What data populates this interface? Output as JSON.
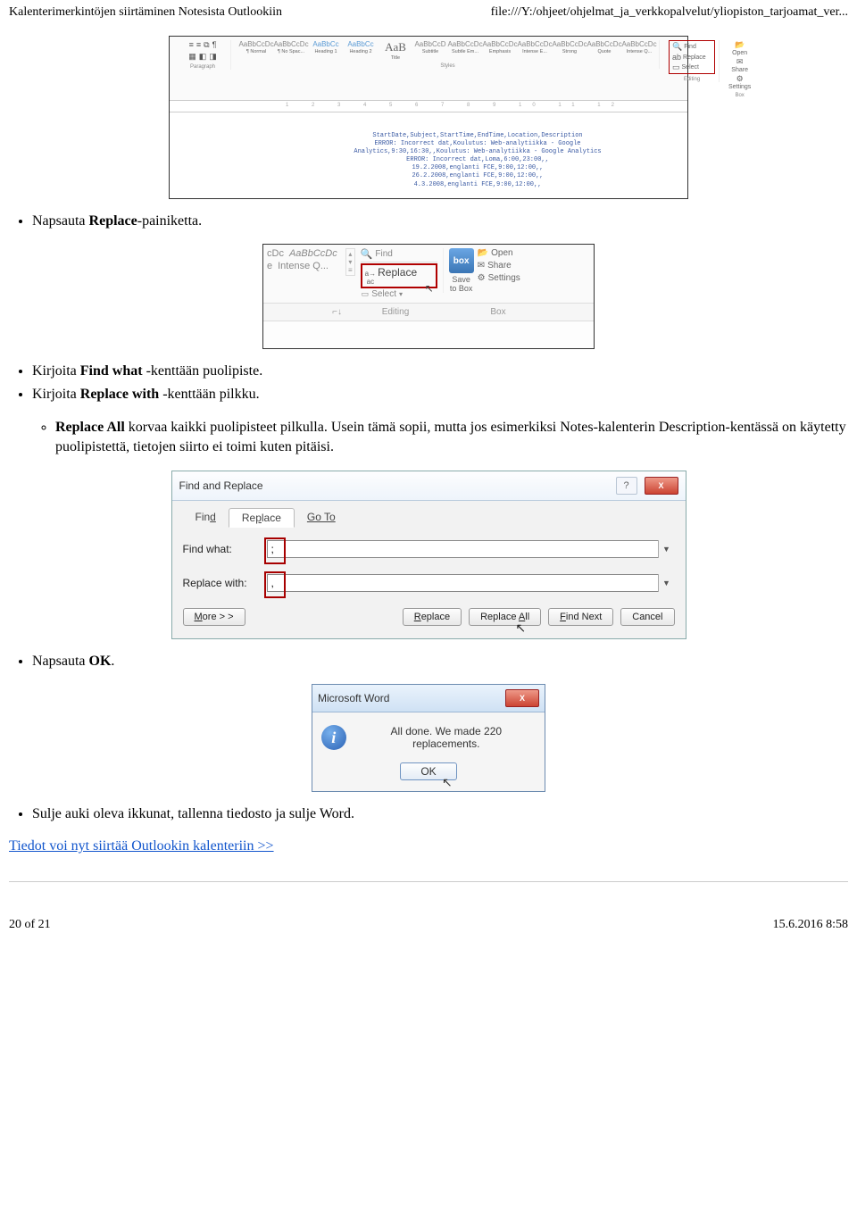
{
  "header": {
    "left": "Kalenterimerkintöjen siirtäminen Notesista Outlookiin",
    "right": "file:///Y:/ohjeet/ohjelmat_ja_verkkopalvelut/yliopiston_tarjoamat_ver..."
  },
  "footer": {
    "left": "20 of 21",
    "right": "15.6.2016 8:58"
  },
  "bullets": {
    "b1a": "Napsauta ",
    "b1b": "Replace",
    "b1c": "-painiketta.",
    "b2a": "Kirjoita ",
    "b2b": "Find what",
    "b2c": " -kenttään puolipiste.",
    "b3a": "Kirjoita ",
    "b3b": "Replace with",
    "b3c": " -kenttään pilkku.",
    "b4a": "Replace All",
    "b4b": " korvaa kaikki puolipisteet pilkulla. Usein tämä sopii, mutta jos esimerkiksi Notes-kalenterin Description-kentässä on käytetty puolipistettä, tietojen siirto ei toimi kuten pitäisi.",
    "b5a": "Napsauta ",
    "b5b": "OK",
    "b5c": ".",
    "b6": "Sulje auki oleva ikkunat, tallenna tiedosto ja sulje Word."
  },
  "link": "Tiedot voi nyt siirtää Outlookin kalenteriin >>",
  "ss1": {
    "ruler": "1 2 3 4 5 6 7 8 9 10 11 12",
    "groups": {
      "paragraph": "Paragraph",
      "styles": "Styles",
      "editing": "Editing",
      "box": "Box"
    },
    "styles": [
      {
        "p": "AaBbCcDc",
        "n": "¶ Normal"
      },
      {
        "p": "AaBbCcDc",
        "n": "¶ No Spac..."
      },
      {
        "p": "AaBbCc",
        "n": "Heading 1"
      },
      {
        "p": "AaBbCc",
        "n": "Heading 2"
      },
      {
        "p": "AaB",
        "n": "Title"
      },
      {
        "p": "AaBbCcD",
        "n": "Subtitle"
      },
      {
        "p": "AaBbCcDc",
        "n": "Subtle Em..."
      },
      {
        "p": "AaBbCcDc",
        "n": "Emphasis"
      },
      {
        "p": "AaBbCcDc",
        "n": "Intense E..."
      },
      {
        "p": "AaBbCcDc",
        "n": "Strong"
      },
      {
        "p": "AaBbCcDc",
        "n": "Quote"
      },
      {
        "p": "AaBbCcDc",
        "n": "Intense Q..."
      }
    ],
    "editing": {
      "find": "Find",
      "replace": "Replace",
      "select": "Select"
    },
    "boxlinks": {
      "open": "Open",
      "share": "Share",
      "settings": "Settings"
    },
    "doc": "StartDate,Subject,StartTime,EndTime,Location,Description\nERROR: Incorrect dat,Koulutus: Web-analytiikka - Google\nAnalytics,9:30,16:30,,Koulutus: Web-analytiikka - Google Analytics\nERROR: Incorrect dat,Loma,6:00,23:00,,\n19.2.2008,englanti FCE,9:00,12:00,,\n26.2.2008,englanti FCE,9:00,12:00,,\n4.3.2008,englanti FCE,9:00,12:00,,"
  },
  "ss2": {
    "style1": "cDc",
    "style2": "AaBbCcDc",
    "style3": "e",
    "style4": "Intense Q...",
    "find": "Find",
    "replace": "Replace",
    "select": "Select",
    "save": "Save",
    "tobox": "to Box",
    "open": "Open",
    "share": "Share",
    "settings": "Settings",
    "labEditing": "Editing",
    "labBox": "Box",
    "labLeft": "⌐↓",
    "boxtext": "box"
  },
  "ss3": {
    "title": "Find and Replace",
    "tabFind": "Fin",
    "tabFindU": "d",
    "tabReplace": "Re",
    "tabReplaceU": "p",
    "tabReplace2": "lace",
    "tabGoto": "Go To",
    "lblFind": "Find what:",
    "lblReplace": "Replace with:",
    "valFind": ";",
    "valReplace": ",",
    "btnMore": "More > >",
    "btnReplace": "Replace",
    "btnReplaceAll": "Replace All",
    "btnFindNext": "Find Next",
    "btnCancel": "Cancel",
    "closeX": "X",
    "q": "?"
  },
  "ss4": {
    "title": "Microsoft Word",
    "msg": "All done. We made 220 replacements.",
    "ok": "OK",
    "closeX": "X"
  }
}
